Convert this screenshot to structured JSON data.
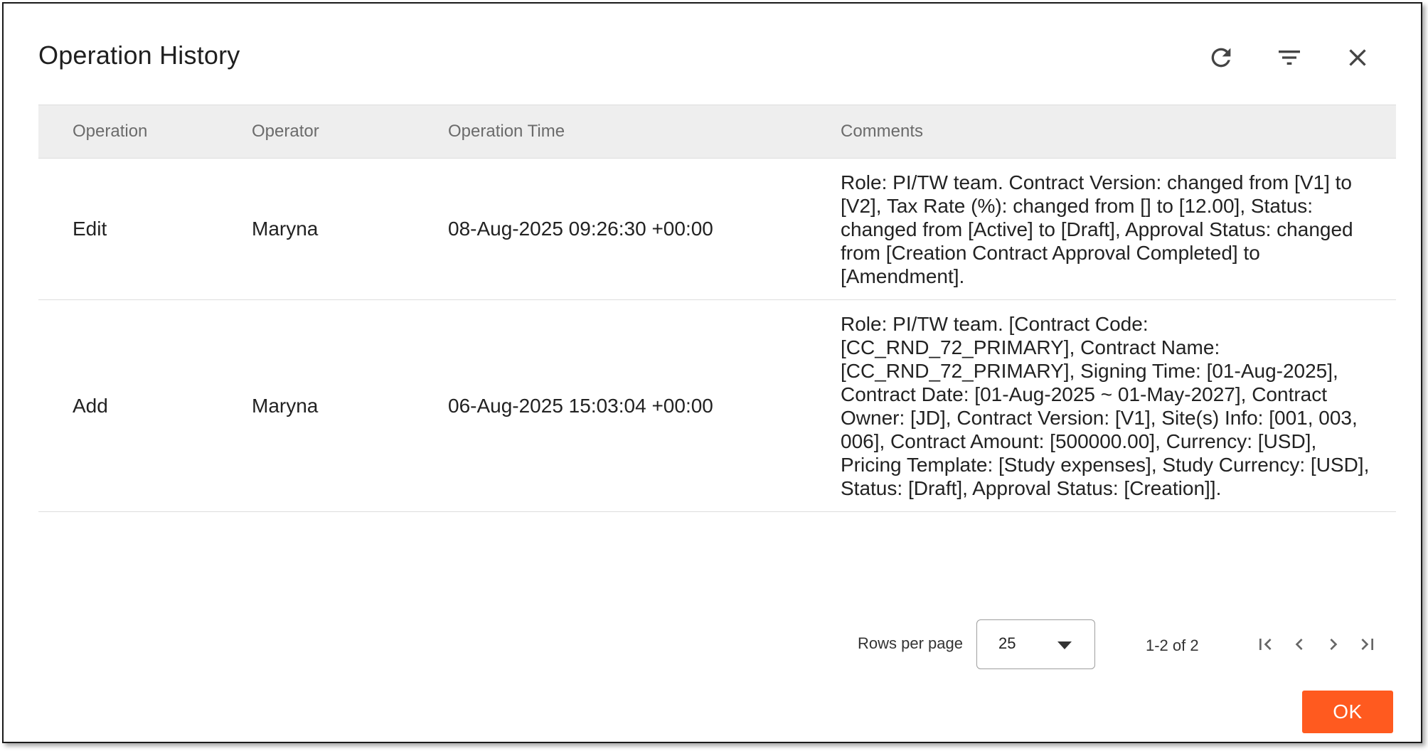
{
  "dialog": {
    "title": "Operation History",
    "icons": {
      "refresh": "refresh-icon",
      "filter": "filter-icon",
      "close": "close-icon"
    }
  },
  "table": {
    "columns": [
      "Operation",
      "Operator",
      "Operation Time",
      "Comments"
    ],
    "rows": [
      {
        "operation": "Edit",
        "operator": "Maryna",
        "time": "08-Aug-2025 09:26:30 +00:00",
        "comments": "Role: PI/TW team. Contract Version: changed from [V1] to [V2], Tax Rate (%): changed from [] to [12.00], Status: changed from [Active] to [Draft], Approval Status: changed from [Creation Contract Approval Completed] to [Amendment]."
      },
      {
        "operation": "Add",
        "operator": "Maryna",
        "time": "06-Aug-2025 15:03:04 +00:00",
        "comments": "Role: PI/TW team. [Contract Code: [CC_RND_72_PRIMARY], Contract Name: [CC_RND_72_PRIMARY], Signing Time: [01-Aug-2025], Contract Date: [01-Aug-2025 ~ 01-May-2027], Contract Owner: [JD], Contract Version: [V1], Site(s) Info: [001, 003, 006], Contract Amount: [500000.00], Currency: [USD], Pricing Template: [Study expenses], Study Currency: [USD], Status: [Draft], Approval Status: [Creation]]."
      }
    ]
  },
  "pagination": {
    "rows_per_page_label": "Rows per page",
    "rows_per_page_value": "25",
    "range_text": "1-2 of 2"
  },
  "footer": {
    "ok_label": "OK"
  },
  "colors": {
    "accent": "#ff5a1f",
    "header_bg": "#eeeeee",
    "border": "#dedede"
  }
}
